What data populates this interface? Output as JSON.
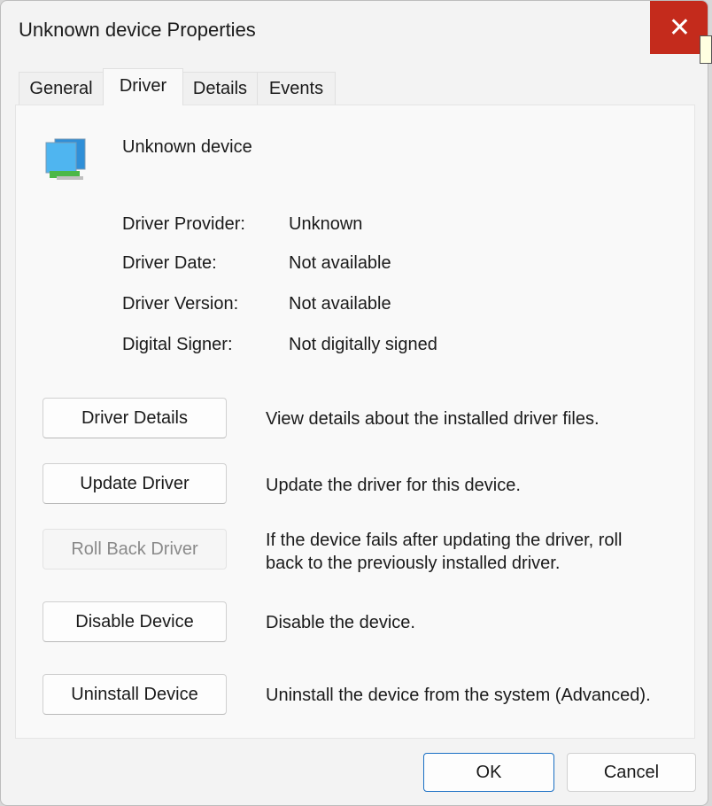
{
  "window": {
    "title": "Unknown device Properties",
    "close_icon": "close-icon",
    "accent": "#c42b1c"
  },
  "tabs": [
    {
      "label": "General"
    },
    {
      "label": "Driver",
      "active": true
    },
    {
      "label": "Details"
    },
    {
      "label": "Events"
    }
  ],
  "device": {
    "name": "Unknown device",
    "icon": "network-adapter-icon"
  },
  "info": [
    {
      "label": "Driver Provider:",
      "value": "Unknown"
    },
    {
      "label": "Driver Date:",
      "value": "Not available"
    },
    {
      "label": "Driver Version:",
      "value": "Not available"
    },
    {
      "label": "Digital Signer:",
      "value": "Not digitally signed"
    }
  ],
  "actions": [
    {
      "label": "Driver Details",
      "desc": "View details about the installed driver files.",
      "enabled": true
    },
    {
      "label": "Update Driver",
      "desc": "Update the driver for this device.",
      "enabled": true
    },
    {
      "label": "Roll Back Driver",
      "desc": "If the device fails after updating the driver, roll back to the previously installed driver.",
      "enabled": false
    },
    {
      "label": "Disable Device",
      "desc": "Disable the device.",
      "enabled": true
    },
    {
      "label": "Uninstall Device",
      "desc": "Uninstall the device from the system (Advanced).",
      "enabled": true
    }
  ],
  "footer": {
    "ok": "OK",
    "cancel": "Cancel"
  }
}
